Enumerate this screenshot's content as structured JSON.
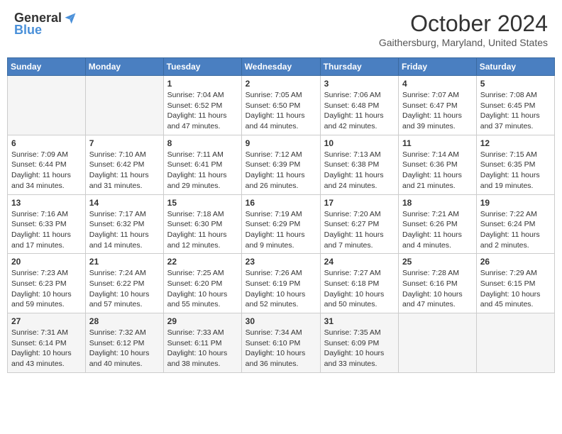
{
  "header": {
    "logo_general": "General",
    "logo_blue": "Blue",
    "month_title": "October 2024",
    "location": "Gaithersburg, Maryland, United States"
  },
  "days_of_week": [
    "Sunday",
    "Monday",
    "Tuesday",
    "Wednesday",
    "Thursday",
    "Friday",
    "Saturday"
  ],
  "weeks": [
    [
      {
        "day": "",
        "empty": true
      },
      {
        "day": "",
        "empty": true
      },
      {
        "day": "1",
        "sunrise": "Sunrise: 7:04 AM",
        "sunset": "Sunset: 6:52 PM",
        "daylight": "Daylight: 11 hours and 47 minutes."
      },
      {
        "day": "2",
        "sunrise": "Sunrise: 7:05 AM",
        "sunset": "Sunset: 6:50 PM",
        "daylight": "Daylight: 11 hours and 44 minutes."
      },
      {
        "day": "3",
        "sunrise": "Sunrise: 7:06 AM",
        "sunset": "Sunset: 6:48 PM",
        "daylight": "Daylight: 11 hours and 42 minutes."
      },
      {
        "day": "4",
        "sunrise": "Sunrise: 7:07 AM",
        "sunset": "Sunset: 6:47 PM",
        "daylight": "Daylight: 11 hours and 39 minutes."
      },
      {
        "day": "5",
        "sunrise": "Sunrise: 7:08 AM",
        "sunset": "Sunset: 6:45 PM",
        "daylight": "Daylight: 11 hours and 37 minutes."
      }
    ],
    [
      {
        "day": "6",
        "sunrise": "Sunrise: 7:09 AM",
        "sunset": "Sunset: 6:44 PM",
        "daylight": "Daylight: 11 hours and 34 minutes."
      },
      {
        "day": "7",
        "sunrise": "Sunrise: 7:10 AM",
        "sunset": "Sunset: 6:42 PM",
        "daylight": "Daylight: 11 hours and 31 minutes."
      },
      {
        "day": "8",
        "sunrise": "Sunrise: 7:11 AM",
        "sunset": "Sunset: 6:41 PM",
        "daylight": "Daylight: 11 hours and 29 minutes."
      },
      {
        "day": "9",
        "sunrise": "Sunrise: 7:12 AM",
        "sunset": "Sunset: 6:39 PM",
        "daylight": "Daylight: 11 hours and 26 minutes."
      },
      {
        "day": "10",
        "sunrise": "Sunrise: 7:13 AM",
        "sunset": "Sunset: 6:38 PM",
        "daylight": "Daylight: 11 hours and 24 minutes."
      },
      {
        "day": "11",
        "sunrise": "Sunrise: 7:14 AM",
        "sunset": "Sunset: 6:36 PM",
        "daylight": "Daylight: 11 hours and 21 minutes."
      },
      {
        "day": "12",
        "sunrise": "Sunrise: 7:15 AM",
        "sunset": "Sunset: 6:35 PM",
        "daylight": "Daylight: 11 hours and 19 minutes."
      }
    ],
    [
      {
        "day": "13",
        "sunrise": "Sunrise: 7:16 AM",
        "sunset": "Sunset: 6:33 PM",
        "daylight": "Daylight: 11 hours and 17 minutes."
      },
      {
        "day": "14",
        "sunrise": "Sunrise: 7:17 AM",
        "sunset": "Sunset: 6:32 PM",
        "daylight": "Daylight: 11 hours and 14 minutes."
      },
      {
        "day": "15",
        "sunrise": "Sunrise: 7:18 AM",
        "sunset": "Sunset: 6:30 PM",
        "daylight": "Daylight: 11 hours and 12 minutes."
      },
      {
        "day": "16",
        "sunrise": "Sunrise: 7:19 AM",
        "sunset": "Sunset: 6:29 PM",
        "daylight": "Daylight: 11 hours and 9 minutes."
      },
      {
        "day": "17",
        "sunrise": "Sunrise: 7:20 AM",
        "sunset": "Sunset: 6:27 PM",
        "daylight": "Daylight: 11 hours and 7 minutes."
      },
      {
        "day": "18",
        "sunrise": "Sunrise: 7:21 AM",
        "sunset": "Sunset: 6:26 PM",
        "daylight": "Daylight: 11 hours and 4 minutes."
      },
      {
        "day": "19",
        "sunrise": "Sunrise: 7:22 AM",
        "sunset": "Sunset: 6:24 PM",
        "daylight": "Daylight: 11 hours and 2 minutes."
      }
    ],
    [
      {
        "day": "20",
        "sunrise": "Sunrise: 7:23 AM",
        "sunset": "Sunset: 6:23 PM",
        "daylight": "Daylight: 10 hours and 59 minutes."
      },
      {
        "day": "21",
        "sunrise": "Sunrise: 7:24 AM",
        "sunset": "Sunset: 6:22 PM",
        "daylight": "Daylight: 10 hours and 57 minutes."
      },
      {
        "day": "22",
        "sunrise": "Sunrise: 7:25 AM",
        "sunset": "Sunset: 6:20 PM",
        "daylight": "Daylight: 10 hours and 55 minutes."
      },
      {
        "day": "23",
        "sunrise": "Sunrise: 7:26 AM",
        "sunset": "Sunset: 6:19 PM",
        "daylight": "Daylight: 10 hours and 52 minutes."
      },
      {
        "day": "24",
        "sunrise": "Sunrise: 7:27 AM",
        "sunset": "Sunset: 6:18 PM",
        "daylight": "Daylight: 10 hours and 50 minutes."
      },
      {
        "day": "25",
        "sunrise": "Sunrise: 7:28 AM",
        "sunset": "Sunset: 6:16 PM",
        "daylight": "Daylight: 10 hours and 47 minutes."
      },
      {
        "day": "26",
        "sunrise": "Sunrise: 7:29 AM",
        "sunset": "Sunset: 6:15 PM",
        "daylight": "Daylight: 10 hours and 45 minutes."
      }
    ],
    [
      {
        "day": "27",
        "sunrise": "Sunrise: 7:31 AM",
        "sunset": "Sunset: 6:14 PM",
        "daylight": "Daylight: 10 hours and 43 minutes."
      },
      {
        "day": "28",
        "sunrise": "Sunrise: 7:32 AM",
        "sunset": "Sunset: 6:12 PM",
        "daylight": "Daylight: 10 hours and 40 minutes."
      },
      {
        "day": "29",
        "sunrise": "Sunrise: 7:33 AM",
        "sunset": "Sunset: 6:11 PM",
        "daylight": "Daylight: 10 hours and 38 minutes."
      },
      {
        "day": "30",
        "sunrise": "Sunrise: 7:34 AM",
        "sunset": "Sunset: 6:10 PM",
        "daylight": "Daylight: 10 hours and 36 minutes."
      },
      {
        "day": "31",
        "sunrise": "Sunrise: 7:35 AM",
        "sunset": "Sunset: 6:09 PM",
        "daylight": "Daylight: 10 hours and 33 minutes."
      },
      {
        "day": "",
        "empty": true
      },
      {
        "day": "",
        "empty": true
      }
    ]
  ]
}
